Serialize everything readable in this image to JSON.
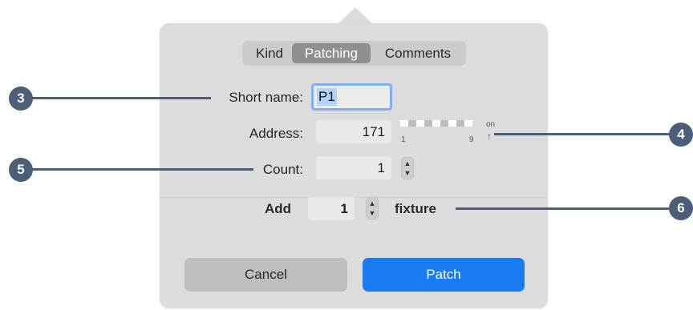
{
  "tabs": [
    {
      "label": "Kind",
      "selected": false
    },
    {
      "label": "Patching",
      "selected": true
    },
    {
      "label": "Comments",
      "selected": false
    }
  ],
  "short_name": {
    "label": "Short name:",
    "value": "P1"
  },
  "address": {
    "label": "Address:",
    "value": "171",
    "indicator_start": "1",
    "indicator_end": "9",
    "on_label": "on",
    "on_arrow": "↑"
  },
  "count": {
    "label": "Count:",
    "value": "1"
  },
  "add_row": {
    "add_label": "Add",
    "quantity": "1",
    "unit_label": "fixture"
  },
  "buttons": {
    "cancel": "Cancel",
    "patch": "Patch"
  },
  "callouts": [
    "3",
    "4",
    "5",
    "6"
  ],
  "colors": {
    "accent": "#1a7cf2",
    "callout": "#4c5f77",
    "panel": "#dcdcdc"
  }
}
